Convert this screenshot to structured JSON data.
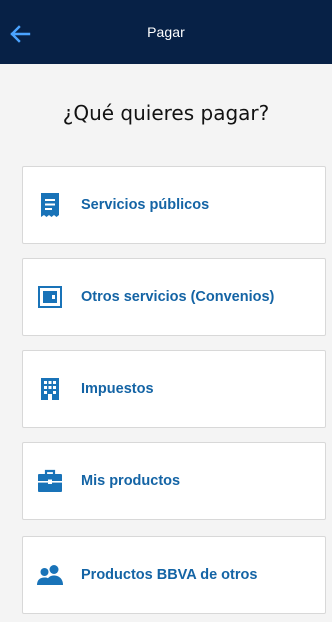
{
  "header": {
    "title": "Pagar",
    "back_icon": "arrow-left-icon"
  },
  "heading": "¿Qué quieres pagar?",
  "colors": {
    "header_bg": "#072146",
    "accent": "#1464a5",
    "icon_blue": "#1973b8"
  },
  "options": [
    {
      "label": "Servicios públicos",
      "icon": "receipt-icon"
    },
    {
      "label": "Otros servicios (Convenios)",
      "icon": "card-box-icon"
    },
    {
      "label": "Impuestos",
      "icon": "building-icon"
    },
    {
      "label": "Mis productos",
      "icon": "briefcase-icon"
    },
    {
      "label": "Productos BBVA de otros",
      "icon": "people-icon"
    }
  ]
}
